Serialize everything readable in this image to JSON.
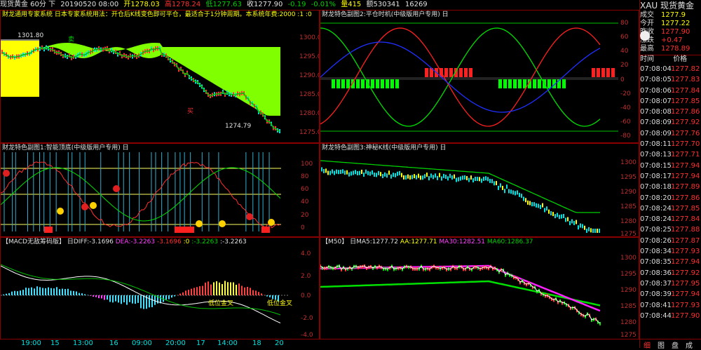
{
  "topbar": {
    "instrument": "现货黄金 60分 下",
    "date": "20190520 08:00",
    "open": "开1278.03",
    "high": "高1278.24",
    "low": "低1277.63",
    "close": "收1277.90",
    "change": "-0.19",
    "pct": "-0.01%",
    "vol": "量415",
    "amount": "额530341",
    "pos": "16269"
  },
  "panels": {
    "main": {
      "title": "财龙通用专家系统 日本专家系统用法：开仓后K线变色即可平仓，最适合于1分钟周期。本系统年费:2000 :1 :0",
      "hi_label": "1301.80",
      "lo_label": "1274.79",
      "mark_sell": "卖",
      "mark_buy": "买",
      "yticks": [
        "1300.0",
        "1295.0",
        "1290.0",
        "1285.0",
        "1280.0",
        "1275.0"
      ]
    },
    "sub2": {
      "title": "财龙特色副图2:平仓时机(中级版用户专用) 日",
      "yticks": [
        "80",
        "60",
        "40",
        "20",
        "0",
        "-20",
        "-40",
        "-60",
        "-80"
      ]
    },
    "sub1": {
      "title": "财龙特色副图1:智能顶底(中级版用户专用) 日",
      "yticks": [
        "100",
        "80",
        "60",
        "40",
        "20",
        "0"
      ]
    },
    "sub3": {
      "title": "财龙特色副图3:神秘K线(中级版用户专用) 日",
      "yticks": [
        "1300",
        "1295",
        "1290",
        "1285",
        "1280",
        "1275"
      ]
    },
    "macd": {
      "title_pre": "【MACD无敌筹码版】",
      "diff": "日DIFF:-3.1696",
      "dea": "DEA:-3.2263",
      "v1": "-3.1696",
      "v2": ":0",
      "v3": ":-3.2263",
      "v4": ":-3.2263",
      "label1": "低位金叉",
      "label2": "低位金叉",
      "yticks": [
        "4.0",
        "2.0",
        "0.0",
        "-2.0",
        "-4.0"
      ]
    },
    "ma": {
      "title": "【M50】",
      "ma5": "日MA5:1277.72",
      "aa": "AA:1277.71",
      "ma30": "MA30:1282.51",
      "ma60": "MA60:1286.37",
      "yticks": [
        "1300",
        "1295",
        "1290",
        "1285",
        "1280",
        "1275"
      ]
    }
  },
  "xaxis": [
    "19:00",
    "15",
    "13:00",
    "16",
    "09:00",
    "20:00",
    "17",
    "14:00",
    "18",
    "20"
  ],
  "quote": {
    "code": "XAU",
    "name": "现货黄金",
    "rows": [
      {
        "k": "成交",
        "v": "1277.9"
      },
      {
        "k": "今开",
        "v": "1277.22"
      },
      {
        "k": "昨收",
        "v": "1277.90"
      },
      {
        "k": "涨跌",
        "v": "+0.47"
      },
      {
        "k": "最高",
        "v": "1278.89"
      }
    ],
    "hdr_time": "时间",
    "hdr_price": "价格"
  },
  "ticks": [
    [
      "07:08:04",
      "1277.82"
    ],
    [
      "07:08:05",
      "1277.83"
    ],
    [
      "07:08:06",
      "1277.84"
    ],
    [
      "07:08:07",
      "1277.85"
    ],
    [
      "07:08:08",
      "1277.86"
    ],
    [
      "07:08:09",
      "1277.92"
    ],
    [
      "07:08:09",
      "1277.76"
    ],
    [
      "07:08:11",
      "1277.70"
    ],
    [
      "07:08:13",
      "1277.71"
    ],
    [
      "07:08:15",
      "1277.94"
    ],
    [
      "07:08:17",
      "1277.94"
    ],
    [
      "07:08:18",
      "1277.89"
    ],
    [
      "07:08:20",
      "1277.86"
    ],
    [
      "07:08:24",
      "1277.85"
    ],
    [
      "07:08:24",
      "1277.84"
    ],
    [
      "07:08:25",
      "1277.88"
    ],
    [
      "07:08:26",
      "1277.87"
    ],
    [
      "07:08:34",
      "1277.93"
    ],
    [
      "07:08:35",
      "1277.94"
    ],
    [
      "07:08:36",
      "1277.92"
    ],
    [
      "07:08:37",
      "1277.95"
    ],
    [
      "07:08:39",
      "1277.94"
    ],
    [
      "07:08:41",
      "1277.93"
    ],
    [
      "07:08:44",
      "1277.90"
    ]
  ],
  "tabs": [
    "细",
    "图",
    "盘",
    "成"
  ],
  "colors": {
    "up": "#ff3030",
    "down": "#00e0e0",
    "border": "#8a0000"
  }
}
